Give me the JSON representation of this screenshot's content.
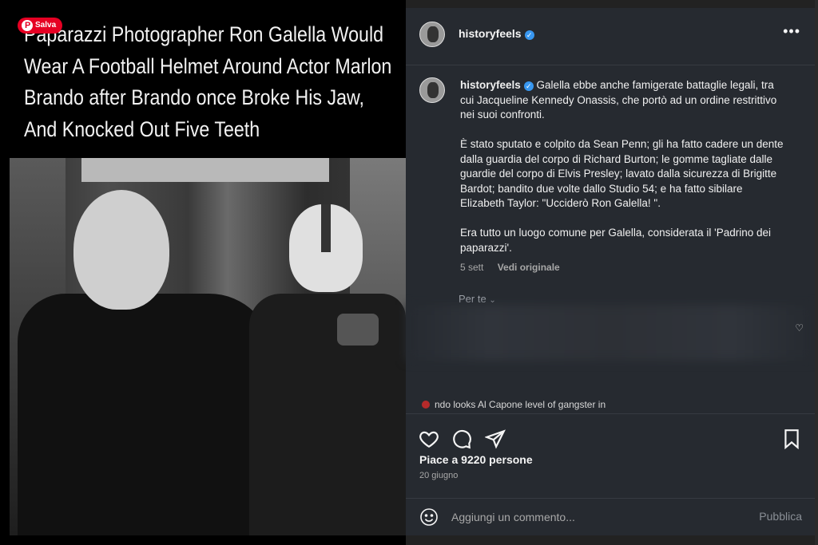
{
  "pin": {
    "save_label": "Salva"
  },
  "post_image": {
    "headline": "Paparazzi Photographer Ron Galella Would Wear A Football Helmet Around Actor Marlon Brando after Brando once Broke His Jaw, And Knocked Out Five Teeth"
  },
  "header": {
    "username": "historyfeels",
    "more": "•••"
  },
  "caption": {
    "username": "historyfeels",
    "paragraphs": [
      "Galella ebbe anche famigerate battaglie legali, tra cui Jacqueline Kennedy Onassis, che portò ad un ordine restrittivo nei suoi confronti.",
      "È stato sputato e colpito da Sean Penn; gli ha fatto cadere un dente dalla guardia del corpo di Richard Burton; le gomme tagliate dalle guardie del corpo di Elvis Presley; lavato dalla sicurezza di Brigitte Bardot; bandito due volte dallo Studio 54; e ha fatto sibilare Elizabeth Taylor: \"Ucciderò Ron Galella! \".",
      "Era tutto un luogo comune per Galella, considerata il 'Padrino dei paparazzi'."
    ],
    "time": "5 sett",
    "see_original": "Vedi originale"
  },
  "translate_label": "Per te",
  "comment_snippet": "ndo looks Al Capone level of gangster in",
  "likes": "Piace a 9220 persone",
  "date": "20 giugno",
  "comment_bar": {
    "placeholder": "Aggiungi un commento...",
    "publish": "Pubblica"
  },
  "colors": {
    "panel": "#262a30",
    "verified": "#3897f0",
    "pinterest": "#e60023"
  }
}
